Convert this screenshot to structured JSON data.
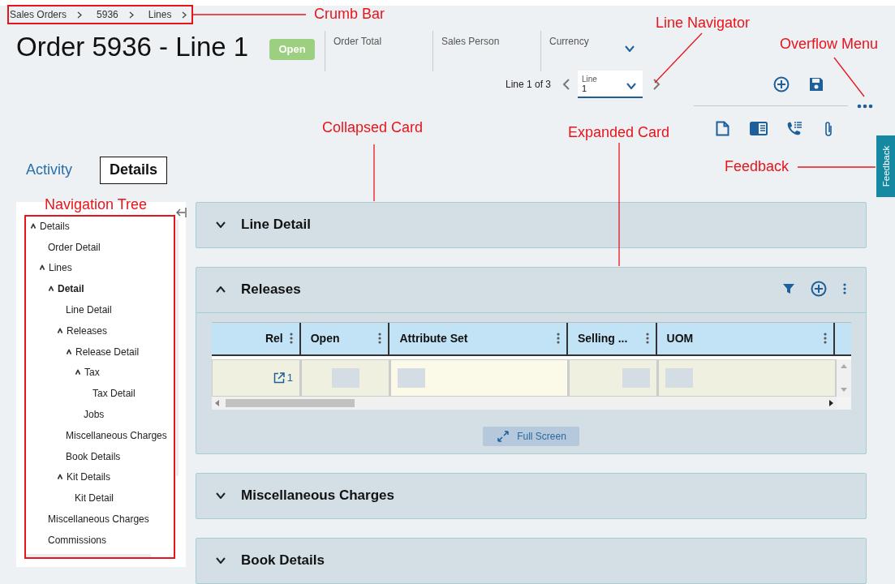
{
  "breadcrumbs": [
    {
      "label": "Sales Orders"
    },
    {
      "label": "5936"
    },
    {
      "label": "Lines"
    }
  ],
  "title": "Order 5936 - Line 1",
  "status_badge": "Open",
  "header_fields": [
    {
      "label": "Order Total",
      "kind": "text"
    },
    {
      "label": "Sales Person",
      "kind": "text"
    },
    {
      "label": "Currency",
      "kind": "dropdown"
    }
  ],
  "line_navigator": {
    "position": "Line 1 of 3",
    "field_label": "Line",
    "value": "1"
  },
  "tabs": [
    {
      "label": "Activity",
      "selected": false
    },
    {
      "label": "Details",
      "selected": true
    }
  ],
  "navigation_tree": [
    {
      "label": "Details",
      "expanded": true,
      "selected": false,
      "children": [
        {
          "label": "Order Detail",
          "selected": false
        },
        {
          "label": "Lines",
          "expanded": true,
          "selected": false,
          "children": [
            {
              "label": "Detail",
              "expanded": true,
              "selected": true,
              "children": [
                {
                  "label": "Line Detail",
                  "selected": false
                },
                {
                  "label": "Releases",
                  "expanded": true,
                  "selected": false,
                  "children": [
                    {
                      "label": "Release Detail",
                      "expanded": true,
                      "selected": false,
                      "children": [
                        {
                          "label": "Tax",
                          "expanded": true,
                          "selected": false,
                          "children": [
                            {
                              "label": "Tax Detail",
                              "selected": false
                            }
                          ]
                        },
                        {
                          "label": "Jobs",
                          "selected": false
                        }
                      ]
                    }
                  ]
                },
                {
                  "label": "Miscellaneous Charges",
                  "selected": false
                },
                {
                  "label": "Book Details",
                  "selected": false
                },
                {
                  "label": "Kit Details",
                  "expanded": true,
                  "selected": false,
                  "children": [
                    {
                      "label": "Kit Detail",
                      "selected": false
                    }
                  ]
                }
              ]
            }
          ]
        },
        {
          "label": "Miscellaneous Charges",
          "selected": false
        },
        {
          "label": "Commissions",
          "selected": false
        }
      ]
    }
  ],
  "cards": [
    {
      "title": "Line Detail",
      "expanded": false
    },
    {
      "title": "Releases",
      "expanded": true,
      "table": {
        "columns": [
          {
            "label": "Rel"
          },
          {
            "label": "Open"
          },
          {
            "label": "Attribute Set"
          },
          {
            "label": "Selling ..."
          },
          {
            "label": "UOM"
          }
        ],
        "rows": [
          {
            "rel": "1"
          }
        ]
      },
      "full_screen_button": "Full Screen"
    },
    {
      "title": "Miscellaneous Charges",
      "expanded": false
    },
    {
      "title": "Book Details",
      "expanded": false
    }
  ],
  "feedback_tab": "Feedback",
  "annotations": [
    {
      "text": "Crumb Bar"
    },
    {
      "text": "Line Navigator"
    },
    {
      "text": "Overflow Menu"
    },
    {
      "text": "Collapsed Card"
    },
    {
      "text": "Expanded Card"
    },
    {
      "text": "Feedback"
    },
    {
      "text": "Navigation Tree"
    }
  ]
}
